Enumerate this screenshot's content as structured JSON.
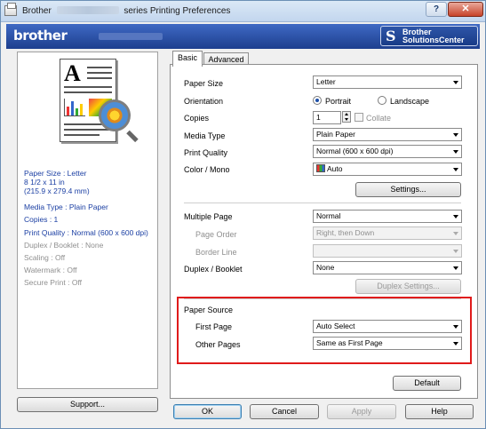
{
  "window": {
    "title_prefix": "Brother",
    "title_suffix": "series Printing Preferences",
    "help_btn": "?",
    "close_btn": "✕"
  },
  "banner": {
    "logo": "brother",
    "solutions_line1": "Brother",
    "solutions_line2": "SolutionsCenter"
  },
  "left_panel": {
    "info": [
      "Paper Size : Letter",
      "8 1/2 x 11 in",
      "(215.9 x 279.4 mm)",
      "Media Type : Plain Paper",
      "Copies : 1",
      "Print Quality : Normal (600 x 600 dpi)",
      "Duplex / Booklet : None",
      "Scaling : Off",
      "Watermark : Off",
      "Secure Print : Off"
    ],
    "support_btn": "Support..."
  },
  "tabs": [
    "Basic",
    "Advanced"
  ],
  "basic": {
    "paper_size_label": "Paper Size",
    "paper_size_value": "Letter",
    "orientation_label": "Orientation",
    "portrait": "Portrait",
    "landscape": "Landscape",
    "orientation_selected": "Portrait",
    "copies_label": "Copies",
    "copies_value": "1",
    "collate": "Collate",
    "media_type_label": "Media Type",
    "media_type_value": "Plain Paper",
    "print_quality_label": "Print Quality",
    "print_quality_value": "Normal (600 x 600 dpi)",
    "color_mono_label": "Color / Mono",
    "color_mono_value": "Auto",
    "settings_btn": "Settings...",
    "multiple_page_label": "Multiple Page",
    "multiple_page_value": "Normal",
    "page_order_label": "Page Order",
    "page_order_value": "Right, then Down",
    "border_line_label": "Border Line",
    "border_line_value": "",
    "duplex_label": "Duplex / Booklet",
    "duplex_value": "None",
    "duplex_settings_btn": "Duplex Settings...",
    "paper_source_label": "Paper Source",
    "first_page_label": "First Page",
    "first_page_value": "Auto Select",
    "other_pages_label": "Other Pages",
    "other_pages_value": "Same as First Page",
    "default_btn": "Default"
  },
  "footer": {
    "ok": "OK",
    "cancel": "Cancel",
    "apply": "Apply",
    "help": "Help"
  },
  "colors": {
    "banner": "#1d3f8e",
    "highlight": "#e01b1b",
    "info_text": "#1b3fa3"
  }
}
